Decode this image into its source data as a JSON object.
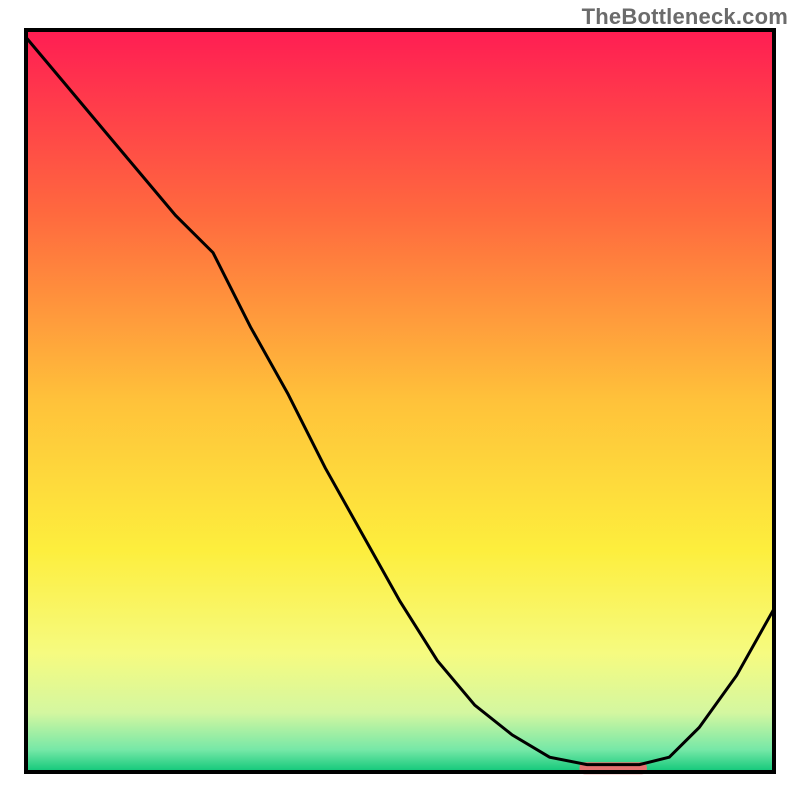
{
  "attribution": "TheBottleneck.com",
  "chart_data": {
    "type": "line",
    "title": "",
    "xlabel": "",
    "ylabel": "",
    "x": [
      0.0,
      0.05,
      0.1,
      0.15,
      0.2,
      0.25,
      0.3,
      0.35,
      0.4,
      0.45,
      0.5,
      0.55,
      0.6,
      0.65,
      0.7,
      0.75,
      0.78,
      0.82,
      0.86,
      0.9,
      0.95,
      1.0
    ],
    "values": [
      0.99,
      0.93,
      0.87,
      0.81,
      0.75,
      0.7,
      0.6,
      0.51,
      0.41,
      0.32,
      0.23,
      0.15,
      0.09,
      0.05,
      0.02,
      0.01,
      0.01,
      0.01,
      0.02,
      0.06,
      0.13,
      0.22
    ],
    "xlim": [
      0,
      1
    ],
    "ylim": [
      0,
      1
    ],
    "marker_segment": {
      "x_start": 0.74,
      "x_end": 0.83,
      "y": 0.005
    },
    "series": [],
    "grid": false,
    "legend": false,
    "background_gradient": {
      "stops": [
        {
          "offset": 0.0,
          "color": "#ff1d53"
        },
        {
          "offset": 0.25,
          "color": "#ff6a3e"
        },
        {
          "offset": 0.5,
          "color": "#ffc23a"
        },
        {
          "offset": 0.7,
          "color": "#fdee3d"
        },
        {
          "offset": 0.84,
          "color": "#f6fb80"
        },
        {
          "offset": 0.92,
          "color": "#d4f7a0"
        },
        {
          "offset": 0.97,
          "color": "#76e8a7"
        },
        {
          "offset": 1.0,
          "color": "#0fc779"
        }
      ]
    },
    "marker_color": "#e4716f",
    "line_color": "#000000",
    "frame_color": "#000000"
  }
}
